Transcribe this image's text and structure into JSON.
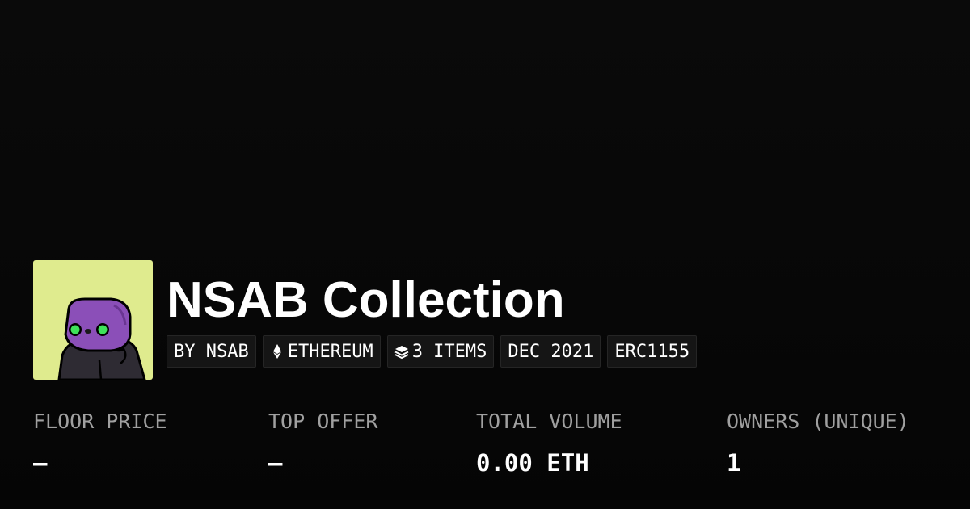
{
  "collection": {
    "name": "NSAB Collection",
    "avatar_bg_color": "#dfeb8e",
    "avatar_character_color": "#8b4fb8",
    "avatar_eye_color": "#3fe15a"
  },
  "tags": [
    {
      "label": "BY NSAB",
      "icon": null
    },
    {
      "label": "ETHEREUM",
      "icon": "ethereum-icon"
    },
    {
      "label": "3 ITEMS",
      "icon": "layers-icon"
    },
    {
      "label": "DEC 2021",
      "icon": null
    },
    {
      "label": "ERC1155",
      "icon": null
    }
  ],
  "stats": {
    "floor_price": {
      "label": "FLOOR PRICE",
      "value": "–"
    },
    "top_offer": {
      "label": "TOP OFFER",
      "value": "–"
    },
    "total_volume": {
      "label": "TOTAL VOLUME",
      "value": "0.00 ETH"
    },
    "owners": {
      "label": "OWNERS (UNIQUE)",
      "value": "1"
    }
  }
}
